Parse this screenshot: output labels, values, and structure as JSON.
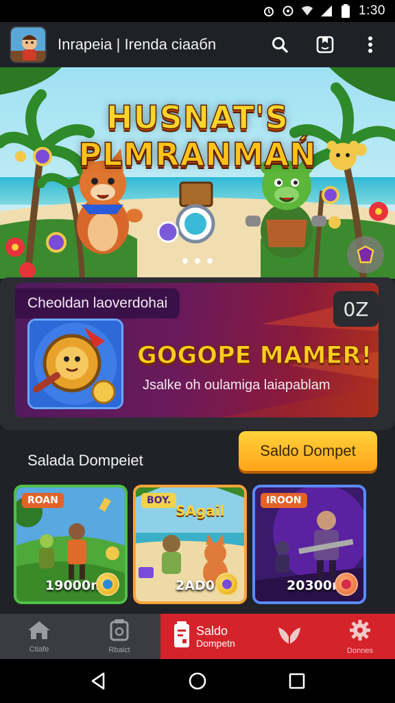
{
  "status_bar": {
    "time": "1:30",
    "icons": [
      "alarm-icon",
      "sync-icon",
      "wifi-icon",
      "signal-icon",
      "battery-icon"
    ]
  },
  "app_bar": {
    "title": "Inrapeia | Irenda ciaaбn",
    "actions": [
      "search-icon",
      "bookmark-icon",
      "more-vert-icon"
    ]
  },
  "hero": {
    "title_line1": "HUSNAT'S",
    "title_line2": "PLMRANMAŃ",
    "slide_count": 3,
    "colors": {
      "title": "#ffd42a",
      "sky": "#7fd3ef",
      "sand": "#f2e2b6"
    }
  },
  "promo": {
    "label": "Cheoldan laoverdohai",
    "timer": "0Z",
    "headline": "GOGOPE MAMER!",
    "subtitle": "Jsalke oh oulamiga laiapablam"
  },
  "section": {
    "title": "Salada Dompeiet",
    "cta_label": "Saldo Dompet"
  },
  "cards": [
    {
      "tag": "ROAN",
      "amount": "19000n",
      "border": "#4ec046",
      "tag_bg": "#e3622a"
    },
    {
      "tag": "BOY.",
      "banner": "SAgail",
      "amount": "2AD0",
      "border": "#ffa33a",
      "tag_bg": "#7a4fd6"
    },
    {
      "tag": "IROON",
      "amount": "20300m",
      "border": "#5a8cff",
      "tag_bg": "#e3622a"
    }
  ],
  "bottom_nav": {
    "items": [
      {
        "icon": "home-icon",
        "label": "Ctiafe"
      },
      {
        "icon": "wallet-icon",
        "label": "Rbaict"
      },
      {
        "icon": "saldo-icon",
        "label": "Saldo",
        "label2": "Dompetn",
        "active": true
      },
      {
        "icon": "leaf-icon",
        "label": ""
      },
      {
        "icon": "gear-icon",
        "label": "Donnes"
      }
    ],
    "active_color": "#d4232a"
  },
  "system_nav": [
    "back-icon",
    "home-circle-icon",
    "recents-icon"
  ]
}
